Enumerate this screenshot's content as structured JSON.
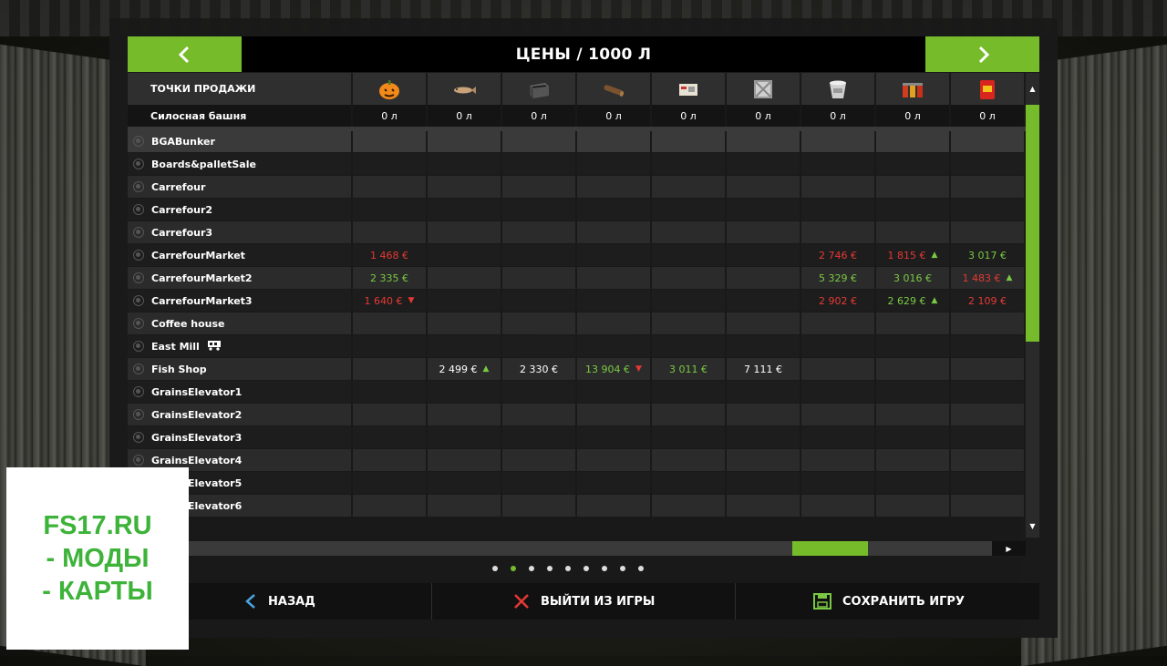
{
  "title": "ЦЕНЫ / 1000 Л",
  "header": {
    "selling_points_label": "ТОЧКИ ПРОДАЖИ",
    "silo_label": "Силосная башня",
    "products": [
      {
        "icon": "pumpkin-icon",
        "silo": "0 л"
      },
      {
        "icon": "fish-icon",
        "silo": "0 л"
      },
      {
        "icon": "planter-box-icon",
        "silo": "0 л"
      },
      {
        "icon": "log-icon",
        "silo": "0 л"
      },
      {
        "icon": "package-icon",
        "silo": "0 л"
      },
      {
        "icon": "crate-icon",
        "silo": "0 л"
      },
      {
        "icon": "bucket-icon",
        "silo": "0 л"
      },
      {
        "icon": "jars-icon",
        "silo": "0 л"
      },
      {
        "icon": "snack-bag-icon",
        "silo": "0 л"
      }
    ]
  },
  "rows": [
    {
      "name": "BGABunker",
      "cells": [
        "",
        "",
        "",
        "",
        "",
        "",
        "",
        "",
        ""
      ]
    },
    {
      "name": "Boards&palletSale",
      "cells": [
        "",
        "",
        "",
        "",
        "",
        "",
        "",
        "",
        ""
      ]
    },
    {
      "name": "Carrefour",
      "cells": [
        "",
        "",
        "",
        "",
        "",
        "",
        "",
        "",
        ""
      ]
    },
    {
      "name": "Carrefour2",
      "cells": [
        "",
        "",
        "",
        "",
        "",
        "",
        "",
        "",
        ""
      ]
    },
    {
      "name": "Carrefour3",
      "cells": [
        "",
        "",
        "",
        "",
        "",
        "",
        "",
        "",
        ""
      ]
    },
    {
      "name": "CarrefourMarket",
      "cells": [
        {
          "v": "1 468 €",
          "c": "red"
        },
        "",
        "",
        "",
        "",
        "",
        {
          "v": "2 746 €",
          "c": "red"
        },
        {
          "v": "1 815 €",
          "c": "red",
          "t": "up"
        },
        {
          "v": "3 017 €",
          "c": "green"
        }
      ]
    },
    {
      "name": "CarrefourMarket2",
      "cells": [
        {
          "v": "2 335 €",
          "c": "green"
        },
        "",
        "",
        "",
        "",
        "",
        {
          "v": "5 329 €",
          "c": "green"
        },
        {
          "v": "3 016 €",
          "c": "green"
        },
        {
          "v": "1 483 €",
          "c": "red",
          "t": "up"
        }
      ]
    },
    {
      "name": "CarrefourMarket3",
      "cells": [
        {
          "v": "1 640 €",
          "c": "red",
          "t": "down"
        },
        "",
        "",
        "",
        "",
        "",
        {
          "v": "2 902 €",
          "c": "red"
        },
        {
          "v": "2 629 €",
          "c": "green",
          "t": "up"
        },
        {
          "v": "2 109 €",
          "c": "red"
        }
      ]
    },
    {
      "name": "Coffee house",
      "cells": [
        "",
        "",
        "",
        "",
        "",
        "",
        "",
        "",
        ""
      ]
    },
    {
      "name": "East Mill",
      "train": true,
      "cells": [
        "",
        "",
        "",
        "",
        "",
        "",
        "",
        "",
        ""
      ]
    },
    {
      "name": "Fish Shop",
      "cells": [
        "",
        {
          "v": "2 499 €",
          "c": "white",
          "t": "up"
        },
        {
          "v": "2 330 €",
          "c": "white"
        },
        {
          "v": "13 904 €",
          "c": "green",
          "t": "down"
        },
        {
          "v": "3 011 €",
          "c": "green"
        },
        {
          "v": "7 111 €",
          "c": "white"
        },
        "",
        "",
        ""
      ]
    },
    {
      "name": "GrainsElevator1",
      "cells": [
        "",
        "",
        "",
        "",
        "",
        "",
        "",
        "",
        ""
      ]
    },
    {
      "name": "GrainsElevator2",
      "cells": [
        "",
        "",
        "",
        "",
        "",
        "",
        "",
        "",
        ""
      ]
    },
    {
      "name": "GrainsElevator3",
      "cells": [
        "",
        "",
        "",
        "",
        "",
        "",
        "",
        "",
        ""
      ]
    },
    {
      "name": "GrainsElevator4",
      "cells": [
        "",
        "",
        "",
        "",
        "",
        "",
        "",
        "",
        ""
      ]
    },
    {
      "name": "GrainsElevator5",
      "cells": [
        "",
        "",
        "",
        "",
        "",
        "",
        "",
        "",
        ""
      ]
    },
    {
      "name": "GrainsElevator6",
      "cells": [
        "",
        "",
        "",
        "",
        "",
        "",
        "",
        "",
        ""
      ]
    }
  ],
  "pagination": {
    "count": 9,
    "active": 1
  },
  "footer": {
    "back_label": "НАЗАД",
    "quit_label": "ВЫЙТИ ИЗ ИГРЫ",
    "save_label": "СОХРАНИТЬ ИГРУ"
  },
  "watermark": {
    "line1": "FS17.RU",
    "line2": "- МОДЫ",
    "line3": "- КАРТЫ"
  },
  "colors": {
    "accent": "#76bb2a",
    "price_up": "#7ac943",
    "price_down": "#e53935"
  }
}
